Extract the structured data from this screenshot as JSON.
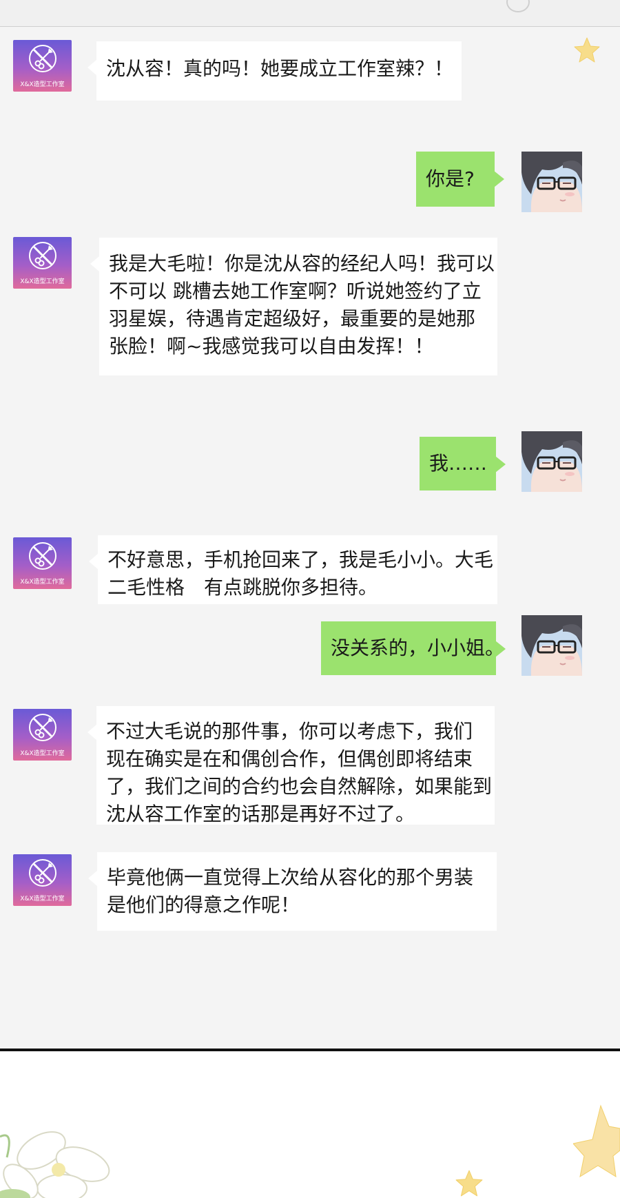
{
  "studio": {
    "avatar_caption": "X&X造型工作室",
    "avatar_icon": "makeup-brush-scissors-icon"
  },
  "me": {
    "avatar_icon": "man-with-glasses-avatar"
  },
  "messages": [
    {
      "from": "studio",
      "lines": [
        "沈从容！真的吗！她要成立工作室辣？！"
      ]
    },
    {
      "from": "me",
      "lines": [
        "你是?"
      ]
    },
    {
      "from": "studio",
      "lines": [
        "我是大毛啦！你是沈从容的经纪人吗！我可以",
        "不可以 跳槽去她工作室啊？听说她签约了立",
        "羽星娱，待遇肯定超级好，最重要的是她那",
        "张脸！啊~我感觉我可以自由发挥！！"
      ]
    },
    {
      "from": "me",
      "lines": [
        "我……"
      ]
    },
    {
      "from": "studio",
      "lines": [
        "不好意思，手机抢回来了，我是毛小小。大毛",
        "二毛性格　有点跳脱你多担待。"
      ]
    },
    {
      "from": "me",
      "lines": [
        "没关系的，小小姐。"
      ]
    },
    {
      "from": "studio",
      "lines": [
        "不过大毛说的那件事，你可以考虑下，我们",
        "现在确实是在和偶创合作，但偶创即将结束",
        "了，我们之间的合约也会自然解除，如果能到",
        "沈从容工作室的话那是再好不过了。"
      ]
    },
    {
      "from": "studio",
      "lines": [
        "毕竟他俩一直觉得上次给从容化的那个男装",
        "是他们的得意之作呢！"
      ]
    }
  ],
  "colors": {
    "chat_background": "#f4f4f4",
    "outgoing_bubble": "#9be26e",
    "incoming_bubble": "#ffffff",
    "star": "#f7dd8a"
  }
}
